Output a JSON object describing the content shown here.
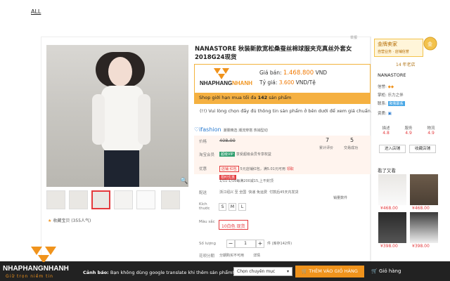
{
  "nav": {
    "all_label": "ALL"
  },
  "report_label": "举报",
  "product": {
    "title": "NANASTORE 秋装新款宽松桑蚕丝棉球服夹克真丝外套女 2018G24现货",
    "price_label": "Giá bán:",
    "price_value": "1.468.800",
    "price_currency": "VND",
    "rate_label": "Tỷ giá:",
    "rate_value": "3.600",
    "rate_unit": "VND/Tệ",
    "limit_text": "Shop giới hạn mua tối đa",
    "limit_count": "142",
    "limit_unit": "sản phẩm",
    "notice": "(!!) Vui lòng chọn đầy đủ thông tin sản phẩm ở bên dưới để xem giá chuẩn.",
    "collect": "收藏宝贝 (355人气)"
  },
  "ifashion": {
    "brand": "ifashion",
    "tagline": "潮量精选 潮流穿搭 热销型动"
  },
  "pricing": {
    "price_label": "价格",
    "original_price": "408.00",
    "vip_label": "淘宝会员",
    "vip_tag": "超级VIP",
    "vip_text": "享受超级会员专享权益",
    "promo_label": "优惠",
    "promo_tag": "店铺 红包",
    "promo_text": "5元店铺红包，满5.01元可用",
    "promo_link": "领取",
    "promo2_tag": "限时优惠",
    "promo2_text": "1/11-1/16每满200减15,上不封顶",
    "reviews_count": "7",
    "reviews_label": "累计评价",
    "sales_count": "5",
    "sales_label": "交易成功"
  },
  "shipping": {
    "label": "配送",
    "from": "浙江绍兴 至 全国",
    "method": "快递 免运费",
    "eta": "付款后45天内发货",
    "stock": "销量数件"
  },
  "options": {
    "size_label": "Kích thước",
    "sizes": [
      "S",
      "M",
      "L"
    ],
    "color_label": "Màu sắc",
    "color_value": "10白色 现货",
    "qty_label": "Số lượng",
    "qty_value": "1",
    "qty_stock": "件 (库存142件)",
    "service_label": "花呗分期",
    "service_value": "分期购买不可用",
    "service_link": "详情"
  },
  "seller": {
    "badge_title": "金牌卖家",
    "badge_sub": "自营业务 · 店铺信誉",
    "years": "14 年老店",
    "shop_name": "NANASTORE",
    "level_label": "信誉:",
    "staff_label": "掌柜:",
    "staff_value": "乐力之伴",
    "contact_label": "联系:",
    "contact_tag": "和我联系",
    "qual_label": "资质:",
    "ratings": [
      {
        "name": "描述",
        "score": "4.8"
      },
      {
        "name": "服务",
        "score": "4.9"
      },
      {
        "name": "物流",
        "score": "4.9"
      }
    ],
    "enter_shop": "进入店铺",
    "favorite_shop": "收藏店铺"
  },
  "see_also": {
    "title": "看了又看",
    "items": [
      {
        "price": "¥468.00"
      },
      {
        "price": "¥468.00"
      },
      {
        "price": "¥398.00"
      },
      {
        "price": "¥398.00"
      }
    ]
  },
  "bottom": {
    "logo_text": "NHAPHANGNHANH",
    "logo_sub": "Giữ trọn niềm tin",
    "warning_bold": "Cảnh báo:",
    "warning_text": "Bạn không dùng google translate khi thêm sản phẩm!",
    "select_value": "Chọn chuyên mục",
    "add_cart": "THÊM VÀO GIỎ HÀNG",
    "cart": "Giỏ hàng"
  },
  "colors": {
    "accent": "#f0931c",
    "red": "#e4393c",
    "limit_bg": "#f5b041",
    "bar_bg": "#222222"
  }
}
